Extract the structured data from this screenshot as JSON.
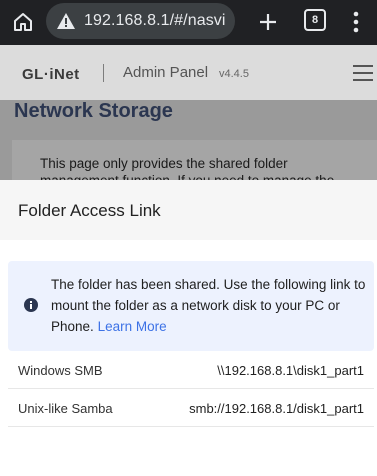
{
  "browser": {
    "url": "192.168.8.1/#/nasvi",
    "tab_count": "8"
  },
  "app": {
    "logo_text": "GL·iNet",
    "title": "Admin Panel",
    "version": "v4.4.5"
  },
  "page": {
    "title": "Network Storage",
    "description": "This page only provides the shared folder management function. If you need to manage the"
  },
  "modal": {
    "title": "Folder Access Link",
    "info_text": "The folder has been shared. Use the following link to mount the folder as a network disk to your PC or Phone.",
    "learn_more": "Learn More",
    "rows": [
      {
        "label": "Windows SMB",
        "value": "\\\\192.168.8.1\\disk1_part1"
      },
      {
        "label": "Unix-like Samba",
        "value": "smb://192.168.8.1/disk1_part1"
      }
    ]
  },
  "colors": {
    "chrome_bg": "#202124",
    "info_bg": "#edf2fe",
    "link": "#3d72e6",
    "title_dark": "#2b3650"
  }
}
